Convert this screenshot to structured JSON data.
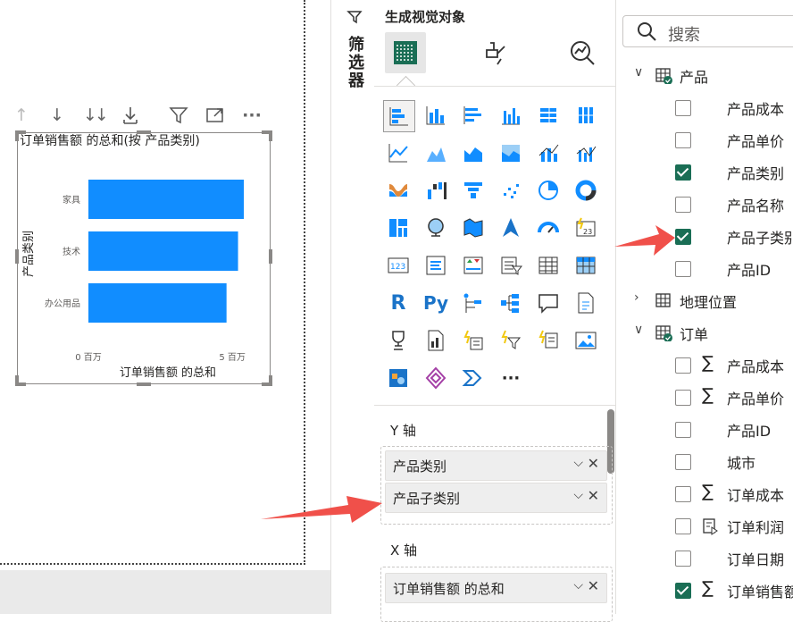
{
  "visual_toolbar": {
    "icons": [
      "arrow-up-icon",
      "arrow-down-icon",
      "double-arrow-down-icon",
      "expand-hierarchy-icon",
      "filter-icon",
      "focus-mode-icon",
      "more-options-icon"
    ],
    "more_label": "···"
  },
  "chart": {
    "title": "订单销售额 的总和(按 产品类别)"
  },
  "chart_data": {
    "type": "bar",
    "orientation": "horizontal",
    "title": "订单销售额 的总和(按 产品类别)",
    "xlabel": "订单销售额 的总和",
    "ylabel": "产品类别",
    "categories": [
      "家具",
      "技术",
      "办公用品"
    ],
    "values": [
      5.4,
      5.2,
      4.8
    ],
    "xlim": [
      0,
      5.4
    ],
    "xticks": [
      {
        "value": 0,
        "label": "0 百万"
      },
      {
        "value": 5,
        "label": "5 百万"
      }
    ],
    "unit": "百万",
    "color": "#118dff",
    "grid": false
  },
  "filters_pane": {
    "label": "筛选器"
  },
  "viz_pane": {
    "title": "生成视觉对象",
    "modes": [
      "build-visual-icon",
      "format-visual-icon",
      "analytics-icon"
    ],
    "more_label": "···",
    "sections": [
      {
        "label": "Y 轴",
        "fields": [
          "产品类别",
          "产品子类别"
        ]
      },
      {
        "label": "X 轴",
        "fields": [
          "订单销售额 的总和"
        ]
      }
    ]
  },
  "data_pane": {
    "search_placeholder": "搜索",
    "tables": [
      {
        "name": "产品",
        "expanded": true,
        "fields": [
          {
            "name": "产品成本",
            "checked": false,
            "sigma": false
          },
          {
            "name": "产品单价",
            "checked": false,
            "sigma": false
          },
          {
            "name": "产品类别",
            "checked": true,
            "sigma": false
          },
          {
            "name": "产品名称",
            "checked": false,
            "sigma": false
          },
          {
            "name": "产品子类别",
            "checked": true,
            "sigma": false
          },
          {
            "name": "产品ID",
            "checked": false,
            "sigma": false
          }
        ]
      },
      {
        "name": "地理位置",
        "expanded": false,
        "fields": []
      },
      {
        "name": "订单",
        "expanded": true,
        "fields": [
          {
            "name": "产品成本",
            "checked": false,
            "sigma": true
          },
          {
            "name": "产品单价",
            "checked": false,
            "sigma": true
          },
          {
            "name": "产品ID",
            "checked": false,
            "sigma": false
          },
          {
            "name": "城市",
            "checked": false,
            "sigma": false
          },
          {
            "name": "订单成本",
            "checked": false,
            "sigma": true
          },
          {
            "name": "订单利润",
            "checked": false,
            "sigma": false,
            "calc": true
          },
          {
            "name": "订单日期",
            "checked": false,
            "sigma": false
          },
          {
            "name": "订单销售额",
            "checked": true,
            "sigma": true
          }
        ]
      }
    ]
  },
  "colors": {
    "accent_green": "#1a6e55",
    "bar_blue": "#118dff",
    "annotation_red": "#f0504a"
  }
}
